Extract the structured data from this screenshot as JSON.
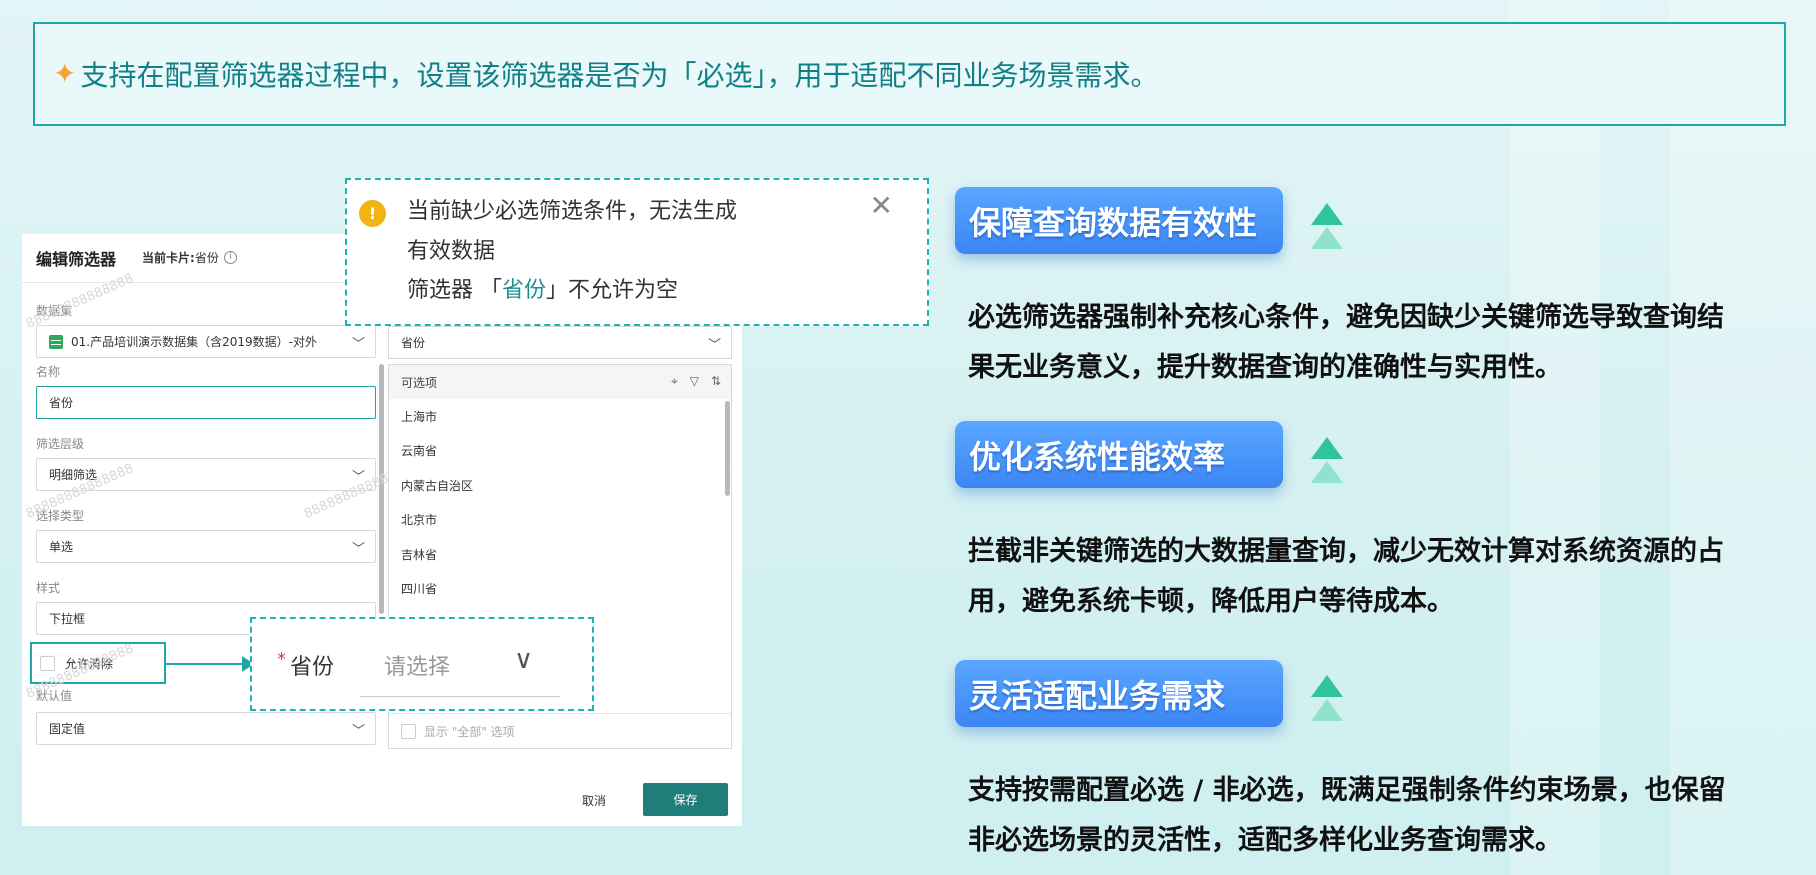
{
  "banner": {
    "icon": "sparkle-icon",
    "text": "支持在配置筛选器过程中，设置该筛选器是否为「必选」，用于适配不同业务场景需求。"
  },
  "dialog": {
    "title": "编辑筛选器",
    "current_card_label": "当前卡片:",
    "current_card_value": "省份",
    "dataset_label": "数据集",
    "dataset_value": "01.产品培训演示数据集（含2019数据）-对外",
    "name_label": "名称",
    "name_value": "省份",
    "level_label": "筛选层级",
    "level_value": "明细筛选",
    "select_type_label": "选择类型",
    "select_type_value": "单选",
    "style_label": "样式",
    "style_value": "下拉框",
    "allow_clear_label": "允许清除",
    "default_label": "默认值",
    "default_value": "固定值",
    "right_select_value": "省份",
    "options_header": "可选项",
    "options": [
      "上海市",
      "云南省",
      "内蒙古自治区",
      "北京市",
      "吉林省",
      "四川省"
    ],
    "show_all_label": "显示 \"全部\" 选项",
    "cancel_label": "取消",
    "save_label": "保存",
    "watermark": "88888888888888"
  },
  "alert": {
    "line1": "当前缺少必选筛选条件，无法生成有效数据",
    "line2_prefix": "筛选器 「",
    "line2_highlight": "省份",
    "line2_suffix": "」不允许为空"
  },
  "preview": {
    "required_mark": "*",
    "label": "省份",
    "placeholder": "请选择"
  },
  "benefits": [
    {
      "title": "保障查询数据有效性",
      "desc": "必选筛选器强制补充核心条件，避免因缺少关键筛选导致查询结果无业务意义，提升数据查询的准确性与实用性。"
    },
    {
      "title": "优化系统性能效率",
      "desc": "拦截非关键筛选的大数据量查询，减少无效计算对系统资源的占用，避免系统卡顿，降低用户等待成本。"
    },
    {
      "title": "灵活适配业务需求",
      "desc": "支持按需配置必选 / 非必选，既满足强制条件约束场景，也保留非必选场景的灵活性，适配多样化业务查询需求。"
    }
  ],
  "colors": {
    "teal": "#1fa8a8",
    "pill_blue": "#3b86f3",
    "save_green": "#1f7e7a",
    "arrow_up": "#2fc59a"
  }
}
